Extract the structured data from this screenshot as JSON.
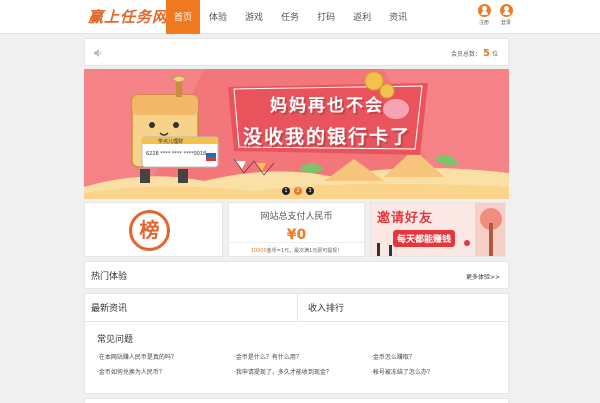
{
  "header": {
    "logo_text": "赢上任务网",
    "nav": [
      {
        "label": "首页"
      },
      {
        "label": "体验"
      },
      {
        "label": "游戏"
      },
      {
        "label": "任务"
      },
      {
        "label": "打码"
      },
      {
        "label": "返利"
      },
      {
        "label": "资讯"
      }
    ],
    "register_label": "注册",
    "login_label": "登录"
  },
  "notice": {
    "member_prefix": "会员总数：",
    "member_count": "5",
    "member_suffix": "位"
  },
  "banner": {
    "line1": "妈妈再也不会",
    "line2": "没收我的银行卡了",
    "card_brand": "学点儿理财",
    "card_number": "6228 **** **** ****0018",
    "slides": [
      "1",
      "2",
      "3"
    ]
  },
  "rank_block": {
    "label": "榜"
  },
  "total_block": {
    "label": "网站总支付人民币",
    "value": "¥0",
    "note_highlight": "10000",
    "note_text": "金币=1元，最次满1元即可提现！"
  },
  "invite_block": {
    "line1": "邀请好友",
    "line2": "每天都能赚钱"
  },
  "hot": {
    "title": "热门体验",
    "more": "更多体验>>"
  },
  "news": {
    "title": "最新资讯"
  },
  "income_rank": {
    "title": "收入排行"
  },
  "faq": {
    "title": "常见问题",
    "items": [
      "在本网站赚人民币是真的吗？",
      "金币是什么？有什么用？",
      "金币怎么赚取？",
      "金币如何兑换为人民币？",
      "我申请提现了，多久才能收到现金？",
      "帐号被冻结了怎么办？"
    ]
  },
  "colors": {
    "accent": "#f07a21",
    "banner_bg": "#f3767a",
    "rank": "#e3652b",
    "invite_red": "#e8343b"
  }
}
